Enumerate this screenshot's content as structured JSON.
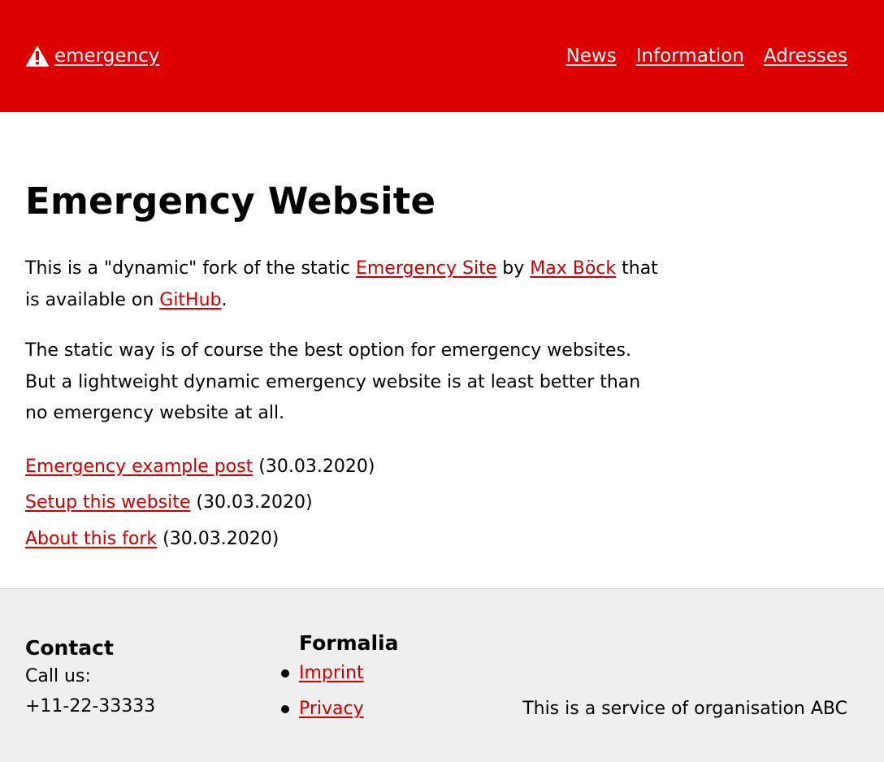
{
  "header": {
    "brand_label": "emergency",
    "brand_icon": "warning-icon",
    "colors": {
      "background": "#dd0000",
      "text": "#ffffff"
    },
    "nav": [
      {
        "label": "News"
      },
      {
        "label": "Information"
      },
      {
        "label": "Adresses"
      }
    ]
  },
  "main": {
    "title": "Emergency Website",
    "intro": {
      "t1": "This is a \"dynamic\" fork of the static ",
      "link1": "Emergency Site",
      "t2": " by ",
      "link2": "Max Böck",
      "t3": " that is available on ",
      "link3": "GitHub",
      "t4": "."
    },
    "paragraph2": "The static way is of course the best option for emergency websites. But a lightweight dynamic emergency website is at least better than no emergency website at all.",
    "posts": [
      {
        "title": "Emergency example post",
        "date": "(30.03.2020)"
      },
      {
        "title": "Setup this website",
        "date": "(30.03.2020)"
      },
      {
        "title": "About this fork",
        "date": "(30.03.2020)"
      }
    ],
    "link_color": "#cc0000"
  },
  "footer": {
    "contact": {
      "title": "Contact",
      "line1": "Call us:",
      "phone": "+11-22-33333"
    },
    "formalia": {
      "title": "Formalia",
      "links": [
        {
          "label": "Imprint"
        },
        {
          "label": "Privacy"
        }
      ]
    },
    "service_text": "This is a service of organisation ABC",
    "background": "#efefef"
  }
}
